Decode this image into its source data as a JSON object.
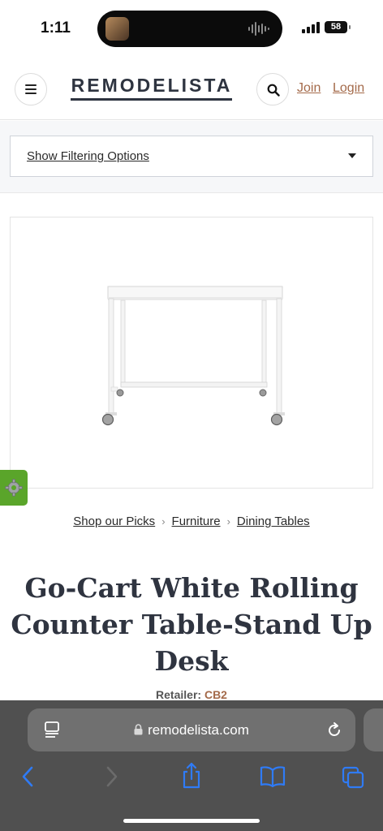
{
  "status_bar": {
    "time": "1:11",
    "battery": "58"
  },
  "header": {
    "logo": "REMODELISTA",
    "join_label": "Join",
    "login_label": "Login"
  },
  "filter": {
    "label": "Show Filtering Options"
  },
  "breadcrumb": {
    "items": [
      "Shop our Picks",
      "Furniture",
      "Dining Tables"
    ],
    "separator": "›"
  },
  "product": {
    "title": "Go-Cart White Rolling Counter Table-Stand Up Desk",
    "retailer_label": "Retailer:",
    "retailer_name": "CB2"
  },
  "browser": {
    "url": "remodelista.com"
  },
  "colors": {
    "accent_link": "#a46a4a",
    "settings_tab": "#5aa52a",
    "toolbar_blue": "#2f7bf6",
    "safari_bar": "#505050"
  },
  "icons": {
    "menu": "hamburger-icon",
    "search": "search-icon",
    "dropdown": "chevron-down-icon",
    "settings": "gear-icon",
    "reader": "reader-mode-icon",
    "lock": "lock-icon",
    "reload": "reload-icon",
    "back": "back-icon",
    "forward": "forward-icon",
    "share": "share-icon",
    "bookmarks": "bookmarks-icon",
    "tabs": "tabs-icon"
  }
}
